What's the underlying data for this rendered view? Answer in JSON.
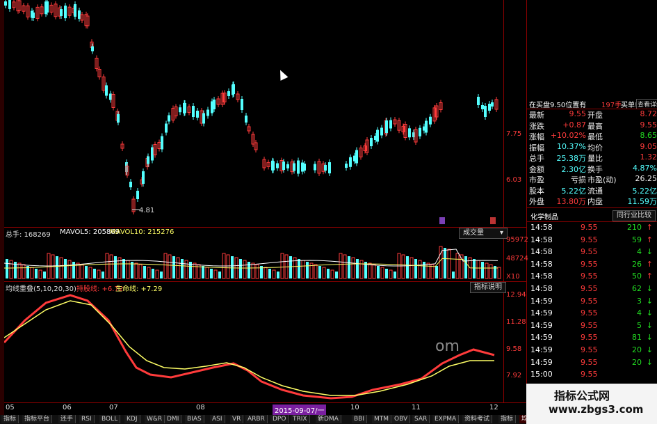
{
  "colors": {
    "up": "#ff3b3b",
    "down": "#54ffff",
    "yellow": "#ffff66",
    "green": "#22dd22",
    "white": "#ffffff",
    "gray": "#cccccc"
  },
  "price_chart": {
    "low_marker": "4.81",
    "y_labels": [
      "7.75",
      "6.03"
    ]
  },
  "volume_panel": {
    "total_label": "总手: 168269",
    "mavol5_label": "MAVOL5: 205869",
    "mavol10_label": "MAVOL10: 215276",
    "select_label": "成交量",
    "y_labels": [
      "95972",
      "48724",
      "X10"
    ]
  },
  "indicator_panel": {
    "name": "均线重叠(5,10,20,30)",
    "line1_label": "持股线: +6.72",
    "line2_label": "生命线: +7.29",
    "help_button": "指标说明",
    "y_labels": [
      "12.94",
      "11.28",
      "9.58",
      "7.92"
    ]
  },
  "x_axis": {
    "ticks": [
      "05",
      "06",
      "07",
      "08",
      "09",
      "10",
      "11",
      "12"
    ],
    "cursor_date": "2015-09-07/一"
  },
  "watermark_text": "om",
  "quote_panel": {
    "order_line": "在买盘9.50位置有",
    "order_qty": "197手",
    "order_side": "买单!",
    "order_detail_btn": "查看详细",
    "rows": [
      {
        "l1": "最新",
        "v1": "9.55",
        "l2": "开盘",
        "v2": "8.72"
      },
      {
        "l1": "涨跌",
        "v1": "+0.87",
        "l2": "最高",
        "v2": "9.55"
      },
      {
        "l1": "涨幅",
        "v1": "+10.02%",
        "l2": "最低",
        "v2": "8.65"
      },
      {
        "l1": "振幅",
        "v1": "10.37%",
        "l2": "均价",
        "v2": "9.05"
      },
      {
        "l1": "总手",
        "v1": "25.38万",
        "l2": "量比",
        "v2": "1.32"
      },
      {
        "l1": "金额",
        "v1": "2.30亿",
        "l2": "换手",
        "v2": "4.87%"
      },
      {
        "l1": "市盈",
        "v1": "亏损",
        "l2": "市盈(动)",
        "v2": "26.25"
      },
      {
        "l1": "股本",
        "v1": "5.22亿",
        "l2": "流通",
        "v2": "5.22亿"
      },
      {
        "l1": "外盘",
        "v1": "13.80万",
        "l2": "内盘",
        "v2": "11.59万"
      }
    ],
    "sector": "化学制品",
    "compare_btn": "同行业比较"
  },
  "trades": [
    {
      "time": "14:58",
      "price": "9.55",
      "vol": "210",
      "dir": "up"
    },
    {
      "time": "14:58",
      "price": "9.55",
      "vol": "59",
      "dir": "up"
    },
    {
      "time": "14:58",
      "price": "9.55",
      "vol": "4",
      "dir": "down"
    },
    {
      "time": "14:58",
      "price": "9.55",
      "vol": "26",
      "dir": "up"
    },
    {
      "time": "14:58",
      "price": "9.55",
      "vol": "50",
      "dir": "up"
    },
    {
      "time": "14:58",
      "price": "9.55",
      "vol": "62",
      "dir": "down"
    },
    {
      "time": "14:59",
      "price": "9.55",
      "vol": "3",
      "dir": "down"
    },
    {
      "time": "14:59",
      "price": "9.55",
      "vol": "4",
      "dir": "down"
    },
    {
      "time": "14:59",
      "price": "9.55",
      "vol": "5",
      "dir": "down"
    },
    {
      "time": "14:59",
      "price": "9.55",
      "vol": "81",
      "dir": "down"
    },
    {
      "time": "14:59",
      "price": "9.55",
      "vol": "20",
      "dir": "down"
    },
    {
      "time": "14:59",
      "price": "9.55",
      "vol": "20",
      "dir": "down"
    },
    {
      "time": "15:00",
      "price": "9.55",
      "vol": "",
      "dir": ""
    }
  ],
  "site_watermark": {
    "title": "指标公式网",
    "url": "www.zbgs3.com"
  },
  "bottom_tabs": [
    "指标",
    "指标平台",
    "还手",
    "RSI",
    "BOLL",
    "KDJ",
    "W&R",
    "DMI",
    "BIAS",
    "ASI",
    "VR",
    "ARBR",
    "DPO",
    "TRIX",
    "新DMA",
    "BBI",
    "MTM",
    "OBV",
    "SAR",
    "EXPMA",
    "资料考试",
    "指标",
    "均线重叠"
  ]
}
